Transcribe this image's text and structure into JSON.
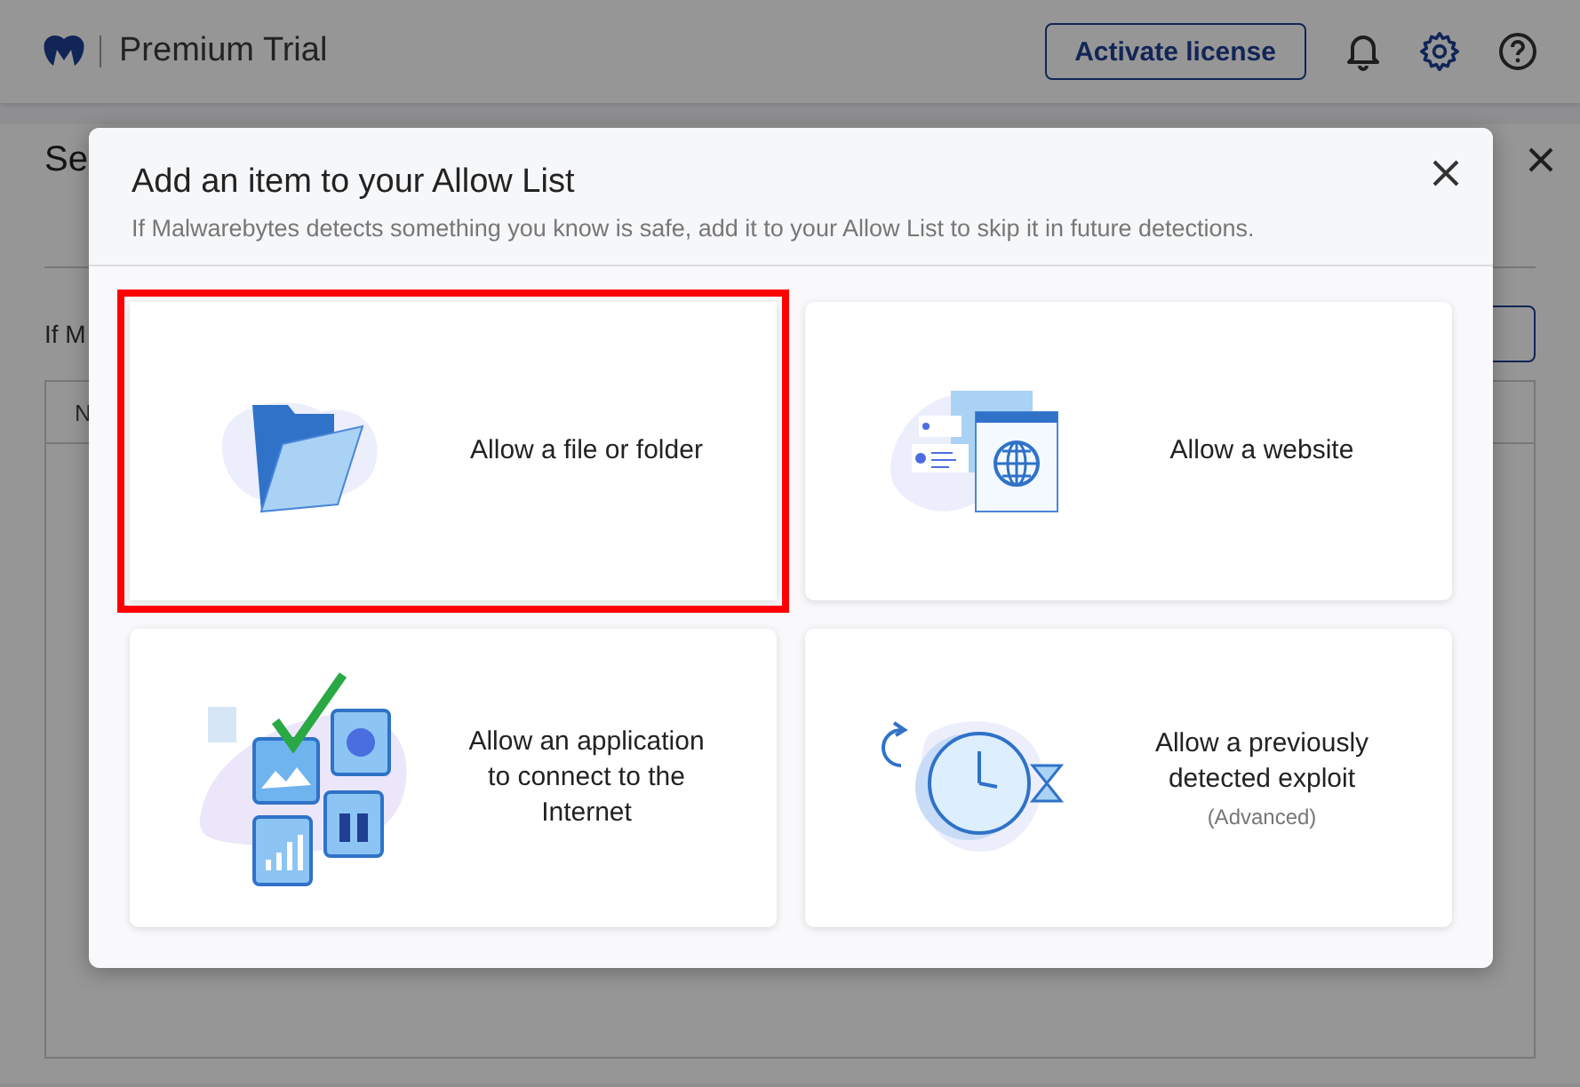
{
  "app": {
    "title": "Premium Trial",
    "activate_button": "Activate license"
  },
  "background": {
    "heading": "Se",
    "description": "If M",
    "column_1": "N"
  },
  "dialog": {
    "title": "Add an item to your Allow List",
    "subtitle": "If Malwarebytes detects something you know is safe, add it to your Allow List to skip it in future detections.",
    "options": [
      {
        "kind": "file",
        "label": "Allow a file or folder",
        "highlighted": true
      },
      {
        "kind": "website",
        "label": "Allow a website",
        "highlighted": false
      },
      {
        "kind": "application",
        "label": "Allow an application to connect to the Internet",
        "highlighted": false
      },
      {
        "kind": "exploit",
        "label": "Allow a previously detected exploit",
        "note": "(Advanced)",
        "highlighted": false
      }
    ]
  }
}
